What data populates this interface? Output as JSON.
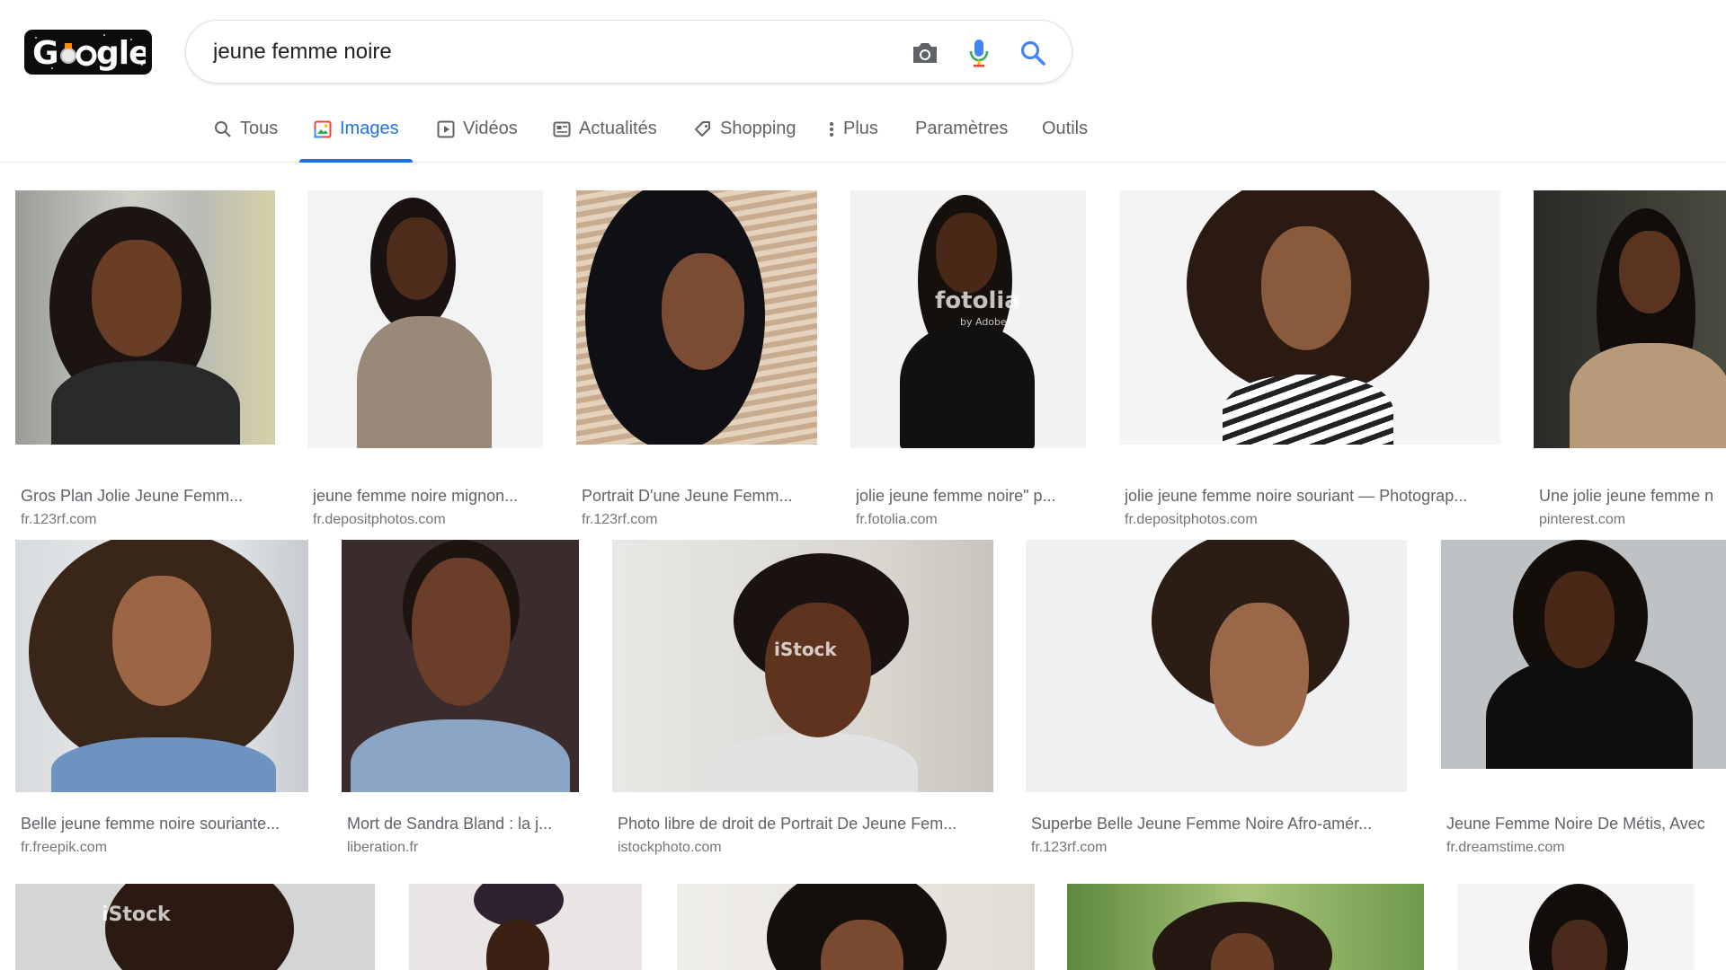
{
  "search": {
    "query": "jeune femme noire"
  },
  "tabs": [
    {
      "label": "Tous",
      "icon": "search-icon",
      "active": false
    },
    {
      "label": "Images",
      "icon": "image-icon",
      "active": true
    },
    {
      "label": "Vidéos",
      "icon": "video-icon",
      "active": false
    },
    {
      "label": "Actualités",
      "icon": "news-icon",
      "active": false
    },
    {
      "label": "Shopping",
      "icon": "tag-icon",
      "active": false
    },
    {
      "label": "Plus",
      "icon": "more-vert-icon",
      "active": false
    },
    {
      "label": "Paramètres",
      "icon": "",
      "active": false
    },
    {
      "label": "Outils",
      "icon": "",
      "active": false
    }
  ],
  "results": [
    {
      "caption": "Gros Plan Jolie Jeune Femm...",
      "source": "fr.123rf.com"
    },
    {
      "caption": "jeune femme noire mignon...",
      "source": "fr.depositphotos.com"
    },
    {
      "caption": "Portrait D'une Jeune Femm...",
      "source": "fr.123rf.com"
    },
    {
      "caption": "jolie jeune femme noire\" p...",
      "source": "fr.fotolia.com",
      "watermark": "fotolia",
      "watermark_sub": "by Adobe"
    },
    {
      "caption": "jolie jeune femme noire souriant — Photograp...",
      "source": "fr.depositphotos.com"
    },
    {
      "caption": "Une jolie jeune femme n",
      "source": "pinterest.com"
    },
    {
      "caption": "Belle jeune femme noire souriante...",
      "source": "fr.freepik.com"
    },
    {
      "caption": "Mort de Sandra Bland : la j...",
      "source": "liberation.fr"
    },
    {
      "caption": "Photo libre de droit de Portrait De Jeune Fem...",
      "source": "istockphoto.com",
      "watermark": "iStock"
    },
    {
      "caption": "Superbe Belle Jeune Femme Noire Afro-amér...",
      "source": "fr.123rf.com"
    },
    {
      "caption": "Jeune Femme Noire De Métis, Avec",
      "source": "fr.dreamstime.com"
    },
    {
      "caption": "",
      "source": "",
      "watermark": "iStock"
    },
    {
      "caption": "",
      "source": ""
    },
    {
      "caption": "",
      "source": ""
    },
    {
      "caption": "",
      "source": ""
    },
    {
      "caption": "",
      "source": ""
    }
  ],
  "colors": {
    "accent": "#1a73e8",
    "text_muted": "#5f6368",
    "source_text": "#70757a"
  }
}
